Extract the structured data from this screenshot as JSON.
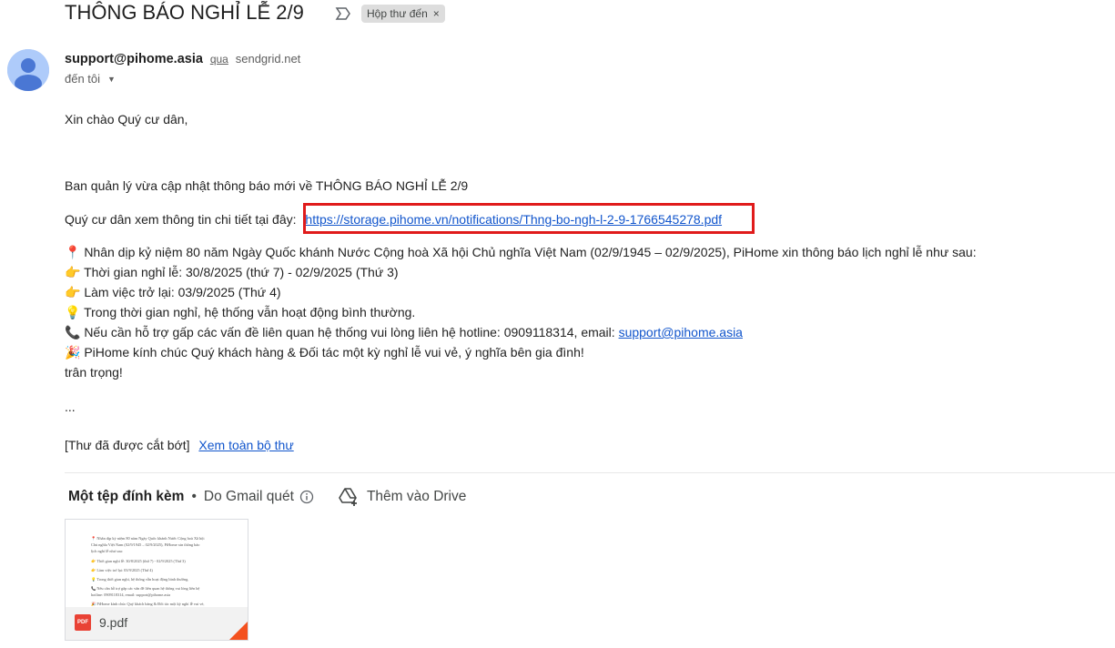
{
  "header": {
    "subject": "THÔNG BÁO NGHỈ LỄ 2/9",
    "label_chip": "Hộp thư đến",
    "label_close": "×"
  },
  "sender": {
    "email": "support@pihome.asia",
    "via_label": "qua",
    "via_domain": "sendgrid.net",
    "to_label": "đến tôi"
  },
  "message": {
    "greeting": "Xin chào Quý cư dân,",
    "intro": "Ban quản lý vừa cập nhật thông báo mới về THÔNG BÁO NGHỈ LỄ 2/9",
    "detail_prefix": "Quý cư dân xem thông tin chi tiết tại đây:",
    "detail_link": "https://storage.pihome.vn/notifications/Thng-bo-ngh-l-2-9-1766545278.pdf",
    "lines": [
      "📍 Nhân dịp kỷ niệm 80 năm Ngày Quốc khánh Nước Cộng hoà Xã hội Chủ nghĩa Việt Nam (02/9/1945 – 02/9/2025), PiHome xin thông báo lịch nghỉ lễ như sau:",
      "👉 Thời gian nghỉ lễ: 30/8/2025 (thứ 7) - 02/9/2025 (Thứ 3)",
      "👉 Làm việc trở lại: 03/9/2025 (Thứ 4)",
      "💡 Trong thời gian nghỉ, hệ thống vẫn hoạt động bình thường."
    ],
    "hotline_prefix": "📞 Nếu cần hỗ trợ gấp các vấn đề liên quan hệ thống vui lòng liên hệ hotline: 0909118314, email:",
    "hotline_email": "support@pihome.asia",
    "wishes": "🎉 PiHome kính chúc Quý khách hàng & Đối tác một kỳ nghỉ lễ vui vẻ, ý nghĩa bên gia đình!",
    "signoff": "trân trọng!",
    "ellipsis": "...",
    "truncated_label": "[Thư đã được cắt bớt]",
    "view_full_label": "Xem toàn bộ thư"
  },
  "attachments": {
    "count_label": "Một tệp đính kèm",
    "scan_label": "Do Gmail quét",
    "drive_label": "Thêm vào Drive",
    "file_name": "9.pdf",
    "file_type": "PDF",
    "preview_lines": [
      "📍 Nhân dịp kỷ niệm 80 năm Ngày Quốc khánh Nước Cộng hoà Xã hội",
      "Chủ nghĩa Việt Nam (02/9/1945 – 02/9/2025), PiHome xin thông báo",
      "lịch nghỉ lễ như sau:",
      "👉 Thời gian nghỉ lễ: 30/8/2025 (thứ 7) - 02/9/2025 (Thứ 3)",
      "👉 Làm việc trở lại: 03/9/2025 (Thứ 4)",
      "💡 Trong thời gian nghỉ, hệ thống vẫn hoạt động bình thường.",
      "📞 Nếu cần hỗ trợ gấp các vấn đề liên quan hệ thống vui lòng liên hệ",
      "hotline: 0909118314, email: support@pihome.asia",
      "🎉 PiHome kính chúc Quý khách hàng & Đối tác một kỳ nghỉ lễ vui vẻ,"
    ]
  },
  "colors": {
    "link": "#1155cc",
    "highlight_box": "#e01b1b",
    "pdf_red": "#e94235"
  }
}
